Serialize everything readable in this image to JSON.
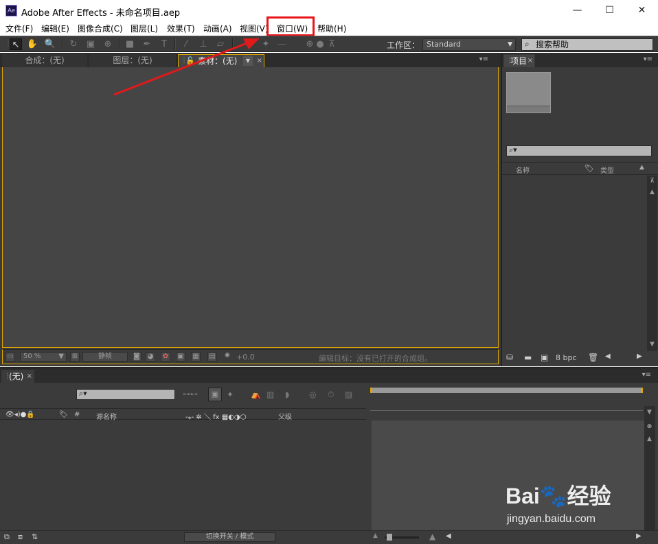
{
  "window": {
    "title": "Adobe After Effects - 未命名项目.aep",
    "minimize": "—",
    "maximize": "☐",
    "close": "✕",
    "app_icon": "Ae"
  },
  "menu": [
    {
      "id": "file",
      "label": "文件(F)"
    },
    {
      "id": "edit",
      "label": "编辑(E)"
    },
    {
      "id": "composition",
      "label": "图像合成(C)"
    },
    {
      "id": "layer",
      "label": "图层(L)"
    },
    {
      "id": "effect",
      "label": "效果(T)"
    },
    {
      "id": "animation",
      "label": "动画(A)"
    },
    {
      "id": "view",
      "label": "视图(V)"
    },
    {
      "id": "window",
      "label": "窗口(W)"
    },
    {
      "id": "help",
      "label": "帮助(H)"
    }
  ],
  "toolbar": {
    "workspace_label": "工作区：",
    "workspace_value": "Standard",
    "search_help": "搜索帮助"
  },
  "viewer": {
    "tabs": [
      "合成：(无)",
      "图层：(无)",
      "素材：(无)"
    ],
    "zoom": "50 %",
    "resolution": "静帧",
    "exposure": "+0.0",
    "target": "编辑目标：没有已打开的合成组。"
  },
  "project": {
    "tab": "项目",
    "col_name": "名称",
    "col_type": "类型",
    "bpc": "8 bpc"
  },
  "timeline": {
    "tab": "(无)",
    "col_source": "源名称",
    "col_parent": "父级",
    "col_hash": "#",
    "switches_mode": "切换开关 / 模式"
  },
  "watermark": {
    "logo": "Bai🐾经验",
    "url": "jingyan.baidu.com"
  },
  "colors": {
    "highlight_box": "#e8141a",
    "active_tab_border": "#e0a800",
    "panel_bg": "#3b3b3b",
    "viewer_bg": "#454545"
  }
}
